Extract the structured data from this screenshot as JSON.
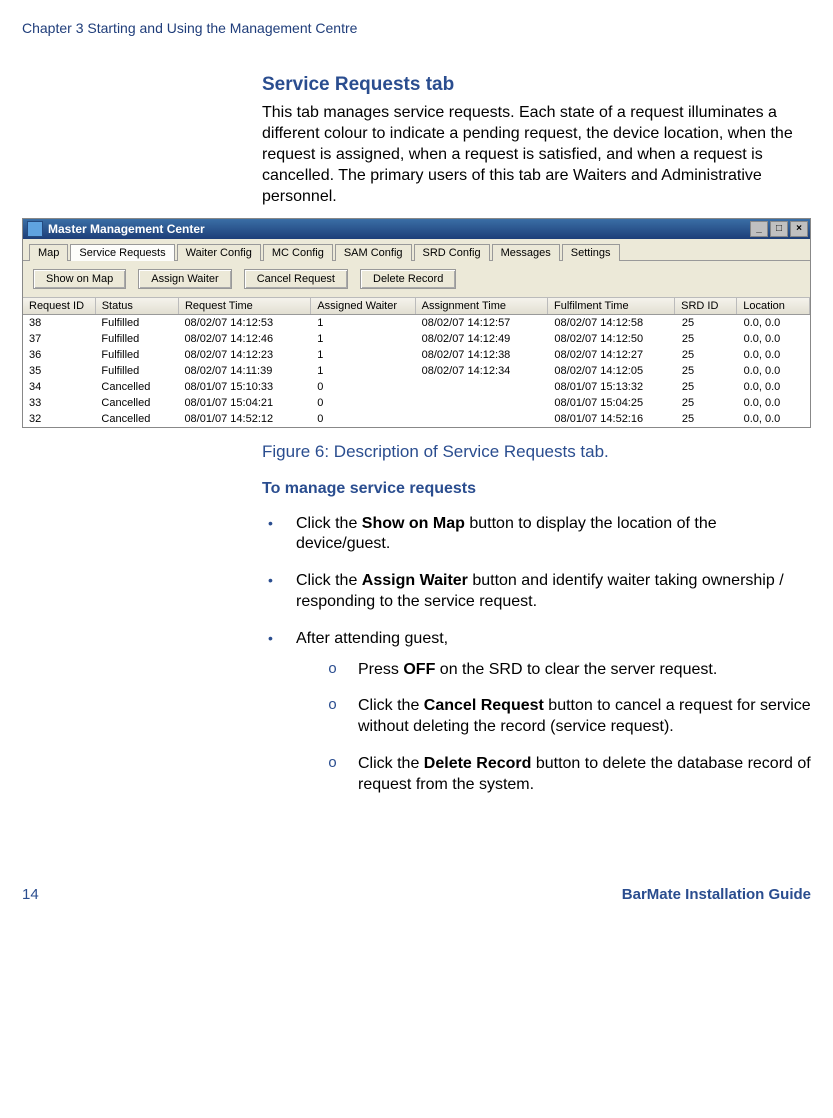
{
  "header": {
    "chapter": "Chapter 3 Starting and Using the Management Centre"
  },
  "section": {
    "title": "Service Requests tab",
    "intro": "This tab manages service requests. Each state of a request illuminates a different colour to indicate a pending request, the device location, when the request is assigned, when a request is satisfied, and when a request is cancelled. The primary users of this tab are Waiters and Administrative personnel."
  },
  "window": {
    "title": "Master Management Center",
    "buttons": {
      "min": "_",
      "max": "□",
      "close": "×"
    },
    "tabs": [
      "Map",
      "Service Requests",
      "Waiter Config",
      "MC Config",
      "SAM Config",
      "SRD Config",
      "Messages",
      "Settings"
    ],
    "active_tab": 1,
    "toolbar": [
      "Show on Map",
      "Assign Waiter",
      "Cancel Request",
      "Delete Record"
    ],
    "columns": [
      "Request ID",
      "Status",
      "Request Time",
      "Assigned Waiter",
      "Assignment Time",
      "Fulfilment Time",
      "SRD ID",
      "Location"
    ],
    "rows": [
      {
        "id": "38",
        "status": "Fulfilled",
        "rt": "08/02/07 14:12:53",
        "aw": "1",
        "at": "08/02/07 14:12:57",
        "ft": "08/02/07 14:12:58",
        "srd": "25",
        "loc": "0.0, 0.0"
      },
      {
        "id": "37",
        "status": "Fulfilled",
        "rt": "08/02/07 14:12:46",
        "aw": "1",
        "at": "08/02/07 14:12:49",
        "ft": "08/02/07 14:12:50",
        "srd": "25",
        "loc": "0.0, 0.0"
      },
      {
        "id": "36",
        "status": "Fulfilled",
        "rt": "08/02/07 14:12:23",
        "aw": "1",
        "at": "08/02/07 14:12:38",
        "ft": "08/02/07 14:12:27",
        "srd": "25",
        "loc": "0.0, 0.0"
      },
      {
        "id": "35",
        "status": "Fulfilled",
        "rt": "08/02/07 14:11:39",
        "aw": "1",
        "at": "08/02/07 14:12:34",
        "ft": "08/02/07 14:12:05",
        "srd": "25",
        "loc": "0.0, 0.0"
      },
      {
        "id": "34",
        "status": "Cancelled",
        "rt": "08/01/07 15:10:33",
        "aw": "0",
        "at": "",
        "ft": "08/01/07 15:13:32",
        "srd": "25",
        "loc": "0.0, 0.0"
      },
      {
        "id": "33",
        "status": "Cancelled",
        "rt": "08/01/07 15:04:21",
        "aw": "0",
        "at": "",
        "ft": "08/01/07 15:04:25",
        "srd": "25",
        "loc": "0.0, 0.0"
      },
      {
        "id": "32",
        "status": "Cancelled",
        "rt": "08/01/07 14:52:12",
        "aw": "0",
        "at": "",
        "ft": "08/01/07 14:52:16",
        "srd": "25",
        "loc": "0.0, 0.0"
      }
    ]
  },
  "figure_caption": "Figure 6: Description of Service Requests tab.",
  "procedure": {
    "heading": "To manage service requests",
    "b1a": "Click the ",
    "b1b": "Show on Map",
    "b1c": " button to display the location of the device/guest.",
    "b2a": "Click the ",
    "b2b": "Assign Waiter",
    "b2c": " button and identify waiter taking ownership / responding to the service request.",
    "b3": "After attending guest,",
    "s1a": "Press ",
    "s1b": "OFF",
    "s1c": " on the SRD to clear the server request.",
    "s2a": "Click the ",
    "s2b": "Cancel Request",
    "s2c": " button to cancel a request for service without deleting the record (service request).",
    "s3a": "Click the ",
    "s3b": "Delete Record",
    "s3c": " button to delete the database record of request from the system."
  },
  "footer": {
    "page": "14",
    "guide": "BarMate Installation Guide"
  }
}
